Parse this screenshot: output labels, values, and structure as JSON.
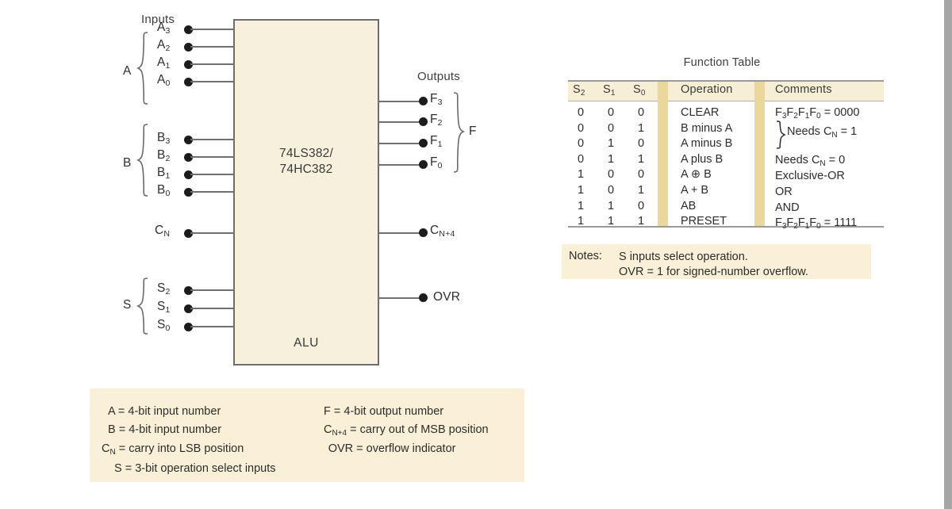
{
  "diagram": {
    "inputs_title": "Inputs",
    "outputs_title": "Outputs",
    "chip_line1": "74LS382/",
    "chip_line2": "74HC382",
    "block_label": "ALU",
    "group_a_letter": "A",
    "group_b_letter": "B",
    "group_s_letter": "S",
    "group_f_letter": "F",
    "a_pins": [
      "A3",
      "A2",
      "A1",
      "A0"
    ],
    "b_pins": [
      "B3",
      "B2",
      "B1",
      "B0"
    ],
    "s_pins": [
      "S2",
      "S1",
      "S0"
    ],
    "cn_pin": "CN",
    "f_pins": [
      "F3",
      "F2",
      "F1",
      "F0"
    ],
    "cn4_pin": "CN+4",
    "ovr_pin": "OVR"
  },
  "legend": {
    "left": [
      "A = 4-bit input number",
      "B = 4-bit input number",
      "CN = carry into LSB position",
      "S = 3-bit operation select inputs"
    ],
    "right": [
      "F = 4-bit output number",
      "CN+4 = carry out of MSB position",
      "OVR = overflow indicator"
    ]
  },
  "function_table": {
    "title": "Function Table",
    "headers": [
      "S2",
      "S1",
      "S0",
      "Operation",
      "Comments"
    ],
    "s2": [
      "0",
      "0",
      "0",
      "0",
      "1",
      "1",
      "1",
      "1"
    ],
    "s1": [
      "0",
      "0",
      "1",
      "1",
      "0",
      "0",
      "1",
      "1"
    ],
    "s0": [
      "0",
      "1",
      "0",
      "1",
      "0",
      "1",
      "0",
      "1"
    ],
    "operations": [
      "CLEAR",
      "B minus A",
      "A minus B",
      "A plus B",
      "A ⊕ B",
      "A + B",
      "AB",
      "PRESET"
    ],
    "comments": [
      "F3F2F1F0 = 0000",
      "",
      "",
      "Needs CN = 0",
      "Exclusive-OR",
      "OR",
      "AND",
      "F3F2F1F0 = 1111"
    ],
    "brace_comment": "Needs CN = 1"
  },
  "notes": {
    "label": "Notes:",
    "line1": "S inputs select operation.",
    "line2": "OVR = 1 for signed-number overflow."
  },
  "colors": {
    "chip_fill": "#f7f0dc",
    "panel_fill": "#faf0d8",
    "table_header_band": "#f6efd6",
    "table_separator": "#ead79a",
    "wire": "#6f6f6f",
    "text": "#2c2c2c"
  }
}
